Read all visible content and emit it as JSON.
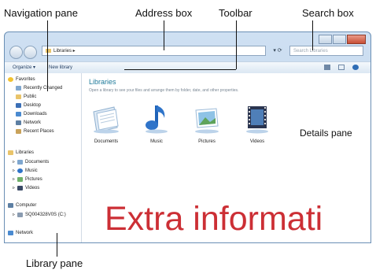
{
  "callouts": {
    "navigation_pane": "Navigation pane",
    "address_box": "Address box",
    "toolbar": "Toolbar",
    "search_box": "Search box",
    "details_pane": "Details pane",
    "library_pane": "Library pane"
  },
  "address_bar": {
    "path": "Libraries",
    "search_placeholder": "Search Libraries"
  },
  "toolbar": {
    "organize": "Organize",
    "new_library": "New library"
  },
  "navigation": {
    "favorites": {
      "label": "Favorites",
      "items": [
        "Recently Changed",
        "Public",
        "Desktop",
        "Downloads",
        "Network",
        "Recent Places"
      ]
    },
    "libraries": {
      "label": "Libraries",
      "items": [
        "Documents",
        "Music",
        "Pictures",
        "Videos"
      ]
    },
    "computer": {
      "label": "Computer",
      "drive": "SQ004328V0S (C:)"
    },
    "network": "Network"
  },
  "library_pane": {
    "title": "Libraries",
    "subtitle": "Open a library to see your files and arrange them by folder, date, and other properties.",
    "items": [
      "Documents",
      "Music",
      "Pictures",
      "Videos"
    ]
  },
  "overlay_text": "Extra informati",
  "colors": {
    "accent": "#1e7a9a",
    "overlay": "#cc2f35",
    "frame": "#b7d0ea"
  }
}
